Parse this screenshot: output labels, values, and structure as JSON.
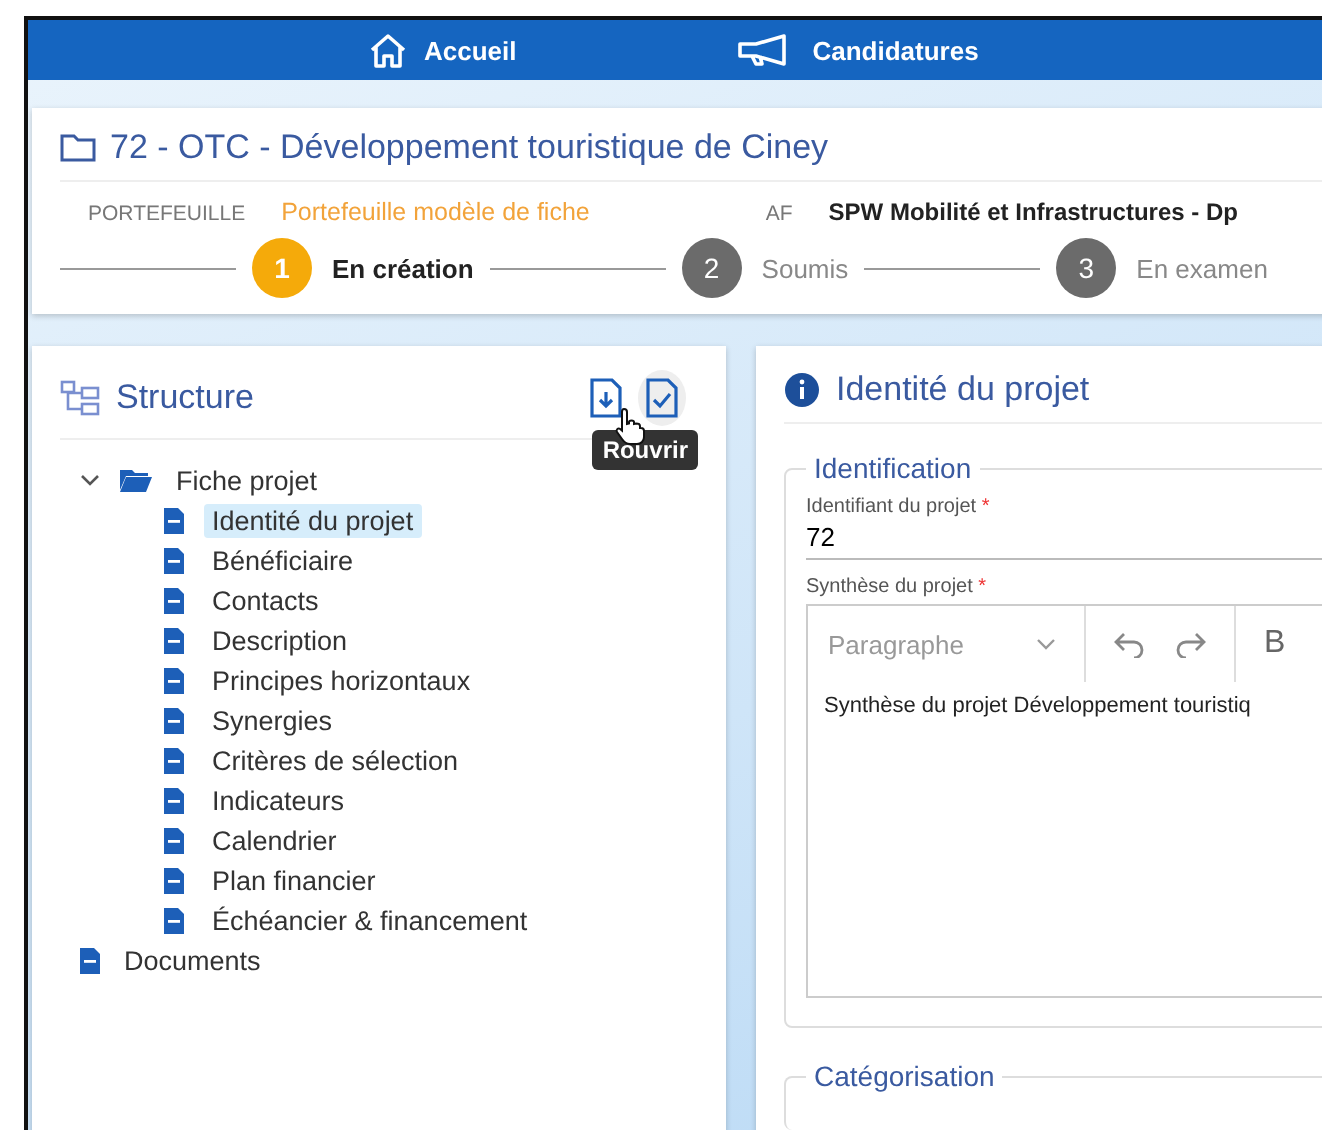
{
  "nav": [
    {
      "kind": "home",
      "label": "Accueil"
    },
    {
      "kind": "megaphone",
      "label": "Candidatures"
    }
  ],
  "header": {
    "title": "72 - OTC - Développement touristique de Ciney",
    "portfolio_label": "PORTEFEUILLE",
    "portfolio_value": "Portefeuille modèle de fiche",
    "af_label": "AF",
    "af_value": "SPW Mobilité et Infrastructures - Dp"
  },
  "steps": [
    {
      "number": "1",
      "label": "En création",
      "selected": true
    },
    {
      "number": "2",
      "label": "Soumis",
      "selected": false
    },
    {
      "number": "3",
      "label": "En examen",
      "selected": false
    }
  ],
  "structure": {
    "title": "Structure",
    "tooltip": "Rouvrir",
    "tree": [
      {
        "label": "Fiche projet",
        "kind": "folder",
        "expanded": true,
        "selected": false,
        "children": [
          {
            "label": "Identité du projet",
            "kind": "file",
            "selected": true
          },
          {
            "label": "Bénéficiaire",
            "kind": "file",
            "selected": false
          },
          {
            "label": "Contacts",
            "kind": "file",
            "selected": false
          },
          {
            "label": "Description",
            "kind": "file",
            "selected": false
          },
          {
            "label": "Principes horizontaux",
            "kind": "file",
            "selected": false
          },
          {
            "label": "Synergies",
            "kind": "file",
            "selected": false
          },
          {
            "label": "Critères de sélection",
            "kind": "file",
            "selected": false
          },
          {
            "label": "Indicateurs",
            "kind": "file",
            "selected": false
          },
          {
            "label": "Calendrier",
            "kind": "file",
            "selected": false
          },
          {
            "label": "Plan financier",
            "kind": "file",
            "selected": false
          },
          {
            "label": "Échéancier & financement",
            "kind": "file",
            "selected": false
          }
        ]
      },
      {
        "label": "Documents",
        "kind": "file",
        "selected": false
      }
    ]
  },
  "form": {
    "title": "Identité du projet",
    "section": "Identification",
    "required_mark": "*",
    "id_label": "Identifiant du projet",
    "id_value": "72",
    "synth_label": "Synthèse du projet",
    "format_placeholder": "Paragraphe",
    "bold_label": "B",
    "synth_value": "Synthèse du projet Développement touristiq",
    "section2": "Catégorisation"
  }
}
